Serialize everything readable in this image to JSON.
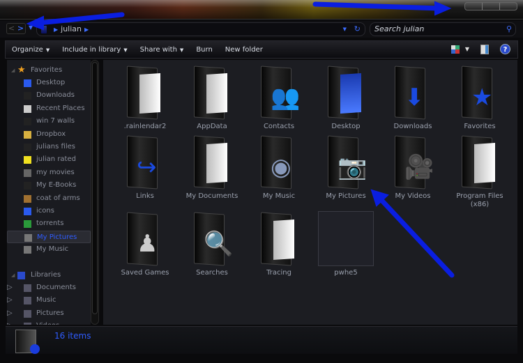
{
  "address": {
    "path": "julian",
    "search_placeholder": "Search julian"
  },
  "toolbar": {
    "organize": "Organize",
    "include": "Include in library",
    "share": "Share with",
    "burn": "Burn",
    "new_folder": "New folder"
  },
  "sidebar": {
    "favorites_header": "Favorites",
    "favorites": [
      {
        "label": "Desktop",
        "color": "#2a5aee"
      },
      {
        "label": "Downloads",
        "color": "#222"
      },
      {
        "label": "Recent Places",
        "color": "#ccc"
      },
      {
        "label": "win 7 walls",
        "color": "#222"
      },
      {
        "label": "Dropbox",
        "color": "#d8b040"
      },
      {
        "label": "julians files",
        "color": "#222"
      },
      {
        "label": "julian rated",
        "color": "#f0e020"
      },
      {
        "label": "my movies",
        "color": "#666"
      },
      {
        "label": "My E-Books",
        "color": "#222"
      },
      {
        "label": "coat of arms",
        "color": "#a07030"
      },
      {
        "label": "icons",
        "color": "#2a5aee"
      },
      {
        "label": "torrents",
        "color": "#2a9a3a"
      },
      {
        "label": "My Pictures",
        "color": "#777",
        "selected": true
      },
      {
        "label": "My Music",
        "color": "#777"
      }
    ],
    "libraries_header": "Libraries",
    "libraries": [
      {
        "label": "Documents"
      },
      {
        "label": "Music"
      },
      {
        "label": "Pictures"
      },
      {
        "label": "Videos"
      }
    ]
  },
  "items": [
    {
      "name": ".rainlendar2",
      "icon": "paper"
    },
    {
      "name": "AppData",
      "icon": "paper"
    },
    {
      "name": "Contacts",
      "icon": "contacts"
    },
    {
      "name": "Desktop",
      "icon": "desktop"
    },
    {
      "name": "Downloads",
      "icon": "download"
    },
    {
      "name": "Favorites",
      "icon": "star"
    },
    {
      "name": "Links",
      "icon": "link"
    },
    {
      "name": "My Documents",
      "icon": "paper"
    },
    {
      "name": "My Music",
      "icon": "music"
    },
    {
      "name": "My Pictures",
      "icon": "camera"
    },
    {
      "name": "My Videos",
      "icon": "video"
    },
    {
      "name": "Program Files (x86)",
      "icon": "paper"
    },
    {
      "name": "Saved Games",
      "icon": "game"
    },
    {
      "name": "Searches",
      "icon": "search"
    },
    {
      "name": "Tracing",
      "icon": "paper"
    },
    {
      "name": "pwhe5",
      "icon": "disc"
    }
  ],
  "status": {
    "count": "16 items"
  },
  "colors": {
    "accent": "#2f5cff",
    "annotation_arrow": "#0a1ee0"
  }
}
